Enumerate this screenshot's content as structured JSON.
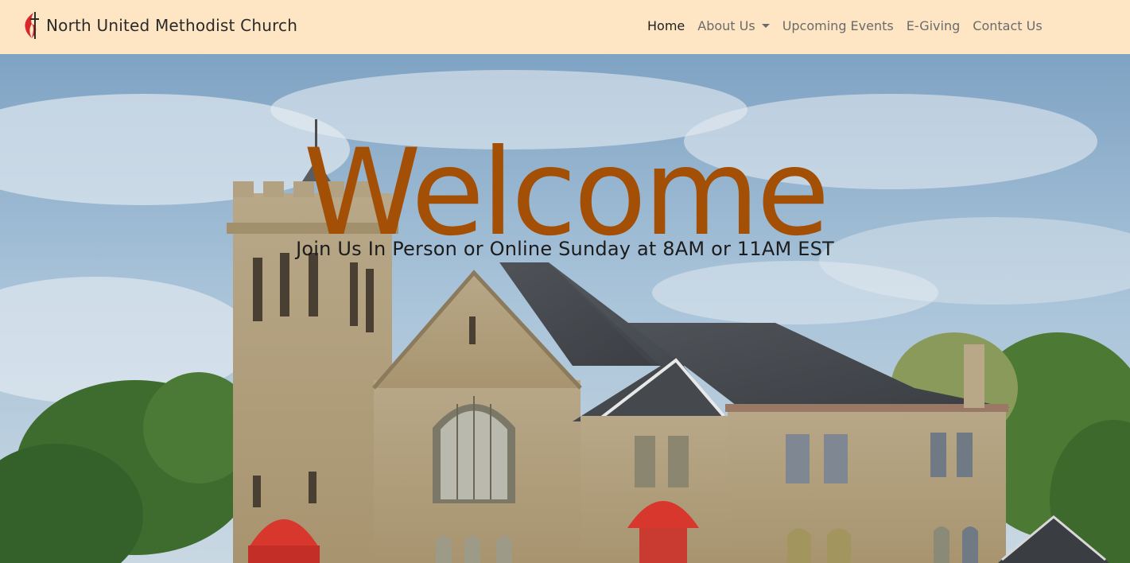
{
  "brand": {
    "name": "North United Methodist Church",
    "logo_icon": "cross-and-flame-icon"
  },
  "nav": {
    "home": "Home",
    "about": "About Us",
    "events": "Upcoming Events",
    "giving": "E-Giving",
    "contact": "Contact Us"
  },
  "hero": {
    "title": "Welcome",
    "subtitle": "Join Us In Person or Online Sunday at 8AM or 11AM EST"
  },
  "colors": {
    "navbar_bg": "#fee6c4",
    "title": "#a34f06",
    "logo_red": "#d9262a",
    "door_red": "#d8372e"
  }
}
